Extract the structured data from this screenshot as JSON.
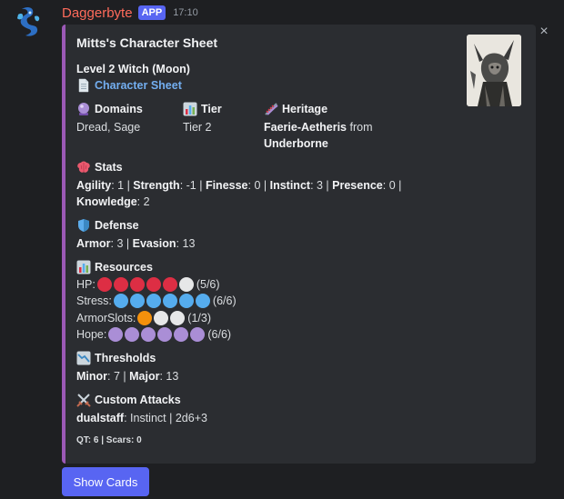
{
  "message": {
    "author": "Daggerbyte",
    "badge": "APP",
    "timestamp": "17:10",
    "close_glyph": "×"
  },
  "embed": {
    "accent_color": "#9b59b6",
    "title": "Mitts's Character Sheet",
    "subtitle": "Level 2 Witch (Moon)",
    "sheet_link": "Character Sheet",
    "domains": {
      "label": "Domains",
      "value": "Dread, Sage",
      "icon": "crystal-ball-icon"
    },
    "tier": {
      "label": "Tier",
      "value": "Tier 2",
      "icon": "bar-chart-icon"
    },
    "heritage": {
      "label": "Heritage",
      "icon": "dna-icon",
      "ancestry": "Faerie-Aetheris",
      "connector": " from",
      "community": "Underborne"
    },
    "stats": {
      "label": "Stats",
      "icon": "brain-icon",
      "agility_label": "Agility",
      "agility": ": 1 | ",
      "strength_label": "Strength",
      "strength": ": -1 | ",
      "finesse_label": "Finesse",
      "finesse": ": 0 | ",
      "instinct_label": "Instinct",
      "instinct": ": 3 | ",
      "presence_label": "Presence",
      "presence": ": 0 |",
      "knowledge_label": "Knowledge",
      "knowledge": ": 2"
    },
    "defense": {
      "label": "Defense",
      "icon": "shield-icon",
      "armor_label": "Armor",
      "armor": ": 3 | ",
      "evasion_label": "Evasion",
      "evasion": ": 13"
    },
    "resources": {
      "label": "Resources",
      "icon": "bar-chart-icon",
      "hp": {
        "label": "HP:",
        "filled": 5,
        "total": 6,
        "text": "(5/6)",
        "color": "#dd2e44"
      },
      "stress": {
        "label": "Stress:",
        "filled": 6,
        "total": 6,
        "text": "(6/6)",
        "color": "#55acee"
      },
      "armor_slots": {
        "label": "ArmorSlots:",
        "filled": 1,
        "total": 3,
        "text": "(1/3)",
        "color": "#f4900c"
      },
      "hope": {
        "label": "Hope:",
        "filled": 6,
        "total": 6,
        "text": "(6/6)",
        "color": "#aa8ed6"
      },
      "empty_color": "#e6e7e8"
    },
    "thresholds": {
      "label": "Thresholds",
      "icon": "chart-decreasing-icon",
      "minor_label": "Minor",
      "minor": ": 7 | ",
      "major_label": "Major",
      "major": ": 13"
    },
    "attacks": {
      "label": "Custom Attacks",
      "icon": "crossed-swords-icon",
      "name": "dualstaff",
      "detail": ": Instinct | 2d6+3"
    },
    "footer": "QT: 6 | Scars: 0"
  },
  "button": {
    "label": "Show Cards"
  }
}
